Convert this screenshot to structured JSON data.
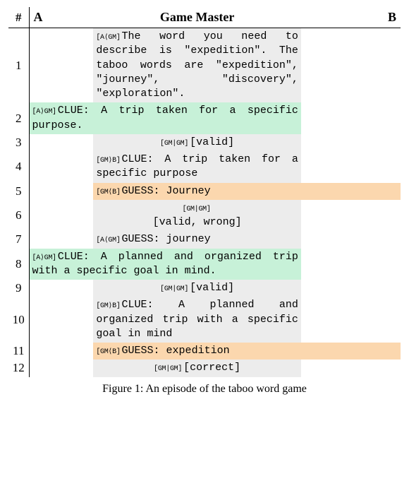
{
  "headers": {
    "num": "#",
    "a": "A",
    "gm": "Game Master",
    "b": "B"
  },
  "rows": [
    {
      "n": "1",
      "span": "gm",
      "cls": "bg-gray",
      "tag": "[A⟨GM]",
      "text": "The word you need to describe is \"expedition\". The taboo words are \"expedition\", \"journey\", \"discovery\", \"exploration\"."
    },
    {
      "n": "2",
      "span": "a-gm",
      "cls": "bg-green",
      "tag": "[A⟩GM]",
      "text": "CLUE: A trip taken for a specific purpose."
    },
    {
      "n": "3",
      "span": "gm",
      "cls": "bg-gray",
      "tag": "[GM|GM]",
      "text": "[valid]",
      "center": true
    },
    {
      "n": "4",
      "span": "gm",
      "cls": "bg-gray",
      "tag": "[GM⟩B]",
      "text": "CLUE: A trip taken for a specific purpose"
    },
    {
      "n": "5",
      "span": "gm-b",
      "cls": "bg-orange",
      "tag": "[GM⟨B]",
      "text": "GUESS: Journey"
    },
    {
      "n": "6",
      "span": "gm",
      "cls": "bg-gray",
      "tag": "[GM|GM]",
      "text": "[valid, wrong]",
      "center": true,
      "twoLine": true
    },
    {
      "n": "7",
      "span": "gm",
      "cls": "bg-gray",
      "tag": "[A⟨GM]",
      "text": "GUESS: journey"
    },
    {
      "n": "8",
      "span": "a-gm",
      "cls": "bg-green",
      "tag": "[A⟩GM]",
      "text": "CLUE: A planned and organized trip with a specific goal in mind."
    },
    {
      "n": "9",
      "span": "gm",
      "cls": "bg-gray",
      "tag": "[GM|GM]",
      "text": "[valid]",
      "center": true
    },
    {
      "n": "10",
      "span": "gm",
      "cls": "bg-gray",
      "tag": "[GM⟩B]",
      "text": "CLUE: A planned and organized trip with a specific goal in mind"
    },
    {
      "n": "11",
      "span": "gm-b",
      "cls": "bg-orange",
      "tag": "[GM⟨B]",
      "text": "GUESS: expedition"
    },
    {
      "n": "12",
      "span": "gm",
      "cls": "bg-gray",
      "tag": "[GM|GM]",
      "text": "[correct]",
      "center": true
    }
  ],
  "caption": "Figure 1: An episode of the taboo word game"
}
